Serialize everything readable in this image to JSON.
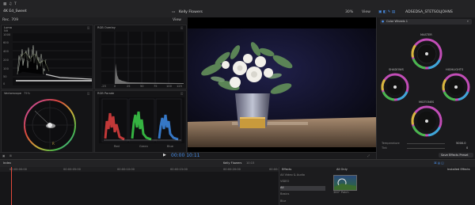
{
  "title_bar": {
    "left_text": "4K Ed_Sweet",
    "clip_name": "Kelly Flowers",
    "zoom": "30%",
    "view_label": "View",
    "inspector_title": "ADSEDSA_STETSOLJOHNS"
  },
  "scopes_header": {
    "left": "Rec. 709",
    "view": "View"
  },
  "scopes": {
    "luma_label": "Luma",
    "luma_unit": "Nit",
    "luma_ticks": [
      "1000",
      "600",
      "400",
      "200",
      "100",
      "50",
      "0"
    ],
    "rgb_overlay_label": "RGB Overlay",
    "rgb_overlay_xticks": [
      "-25",
      "0",
      "25",
      "50",
      "75",
      "100",
      "125"
    ],
    "vectorscope_label": "Vectorscope",
    "vectorscope_sub": "75%",
    "rgb_parade_label": "RGB Parade",
    "parade_channels": [
      "Red",
      "Green",
      "Blue"
    ]
  },
  "transport": {
    "timecode": "00:00 10:11",
    "play_icon": "play-icon"
  },
  "inspector": {
    "mask_label": "Color Wheels 1",
    "wheels": [
      "MASTER",
      "SHADOWS",
      "HIGHLIGHTS",
      "MIDTONES"
    ],
    "temperature_label": "Temperature",
    "temperature_value": "5000.0",
    "tint_label": "Tint",
    "tint_value": "0",
    "save_button": "Save Effects Preset"
  },
  "timeline": {
    "index_label": "Index",
    "clip_name": "Kelly Flowers",
    "duration": "10:15",
    "ruler": [
      "00:00:00:00",
      "00:00:05:00",
      "00:00:10:00",
      "00:00:15:00",
      "00:00:20:00",
      "00:00:25:00"
    ]
  },
  "effects": {
    "title": "Effects",
    "categories": [
      "All Video & Audio",
      "VIDEO",
      "All",
      "Basics",
      "Blur"
    ],
    "selected_index": 2,
    "filter_label": "All Only",
    "installed_label": "Installed Effects",
    "thumb_name": "360° Patch"
  },
  "colors": {
    "accent": "#3d7fe0",
    "playhead": "#e2493a"
  }
}
